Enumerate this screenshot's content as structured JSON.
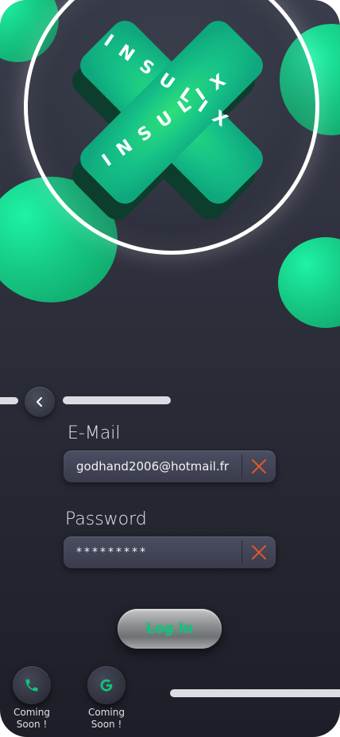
{
  "brand": {
    "logo_text_top": "INSULIX",
    "logo_text_bottom": "INSULIX",
    "logo_color": "#17c987",
    "ring_color": "#ffffff"
  },
  "colors": {
    "background": "#2b2d39",
    "accent": "#16c883",
    "clear_icon": "#e0572a",
    "login_text": "#0ec47c"
  },
  "nav": {
    "back_icon": "chevron-left-icon"
  },
  "form": {
    "email_label": "E-Mail",
    "email_value": "godhand2006@hotmail.fr",
    "password_label": "Password",
    "password_value": "*********",
    "clear_icon": "close-icon"
  },
  "actions": {
    "login_label": "Log In"
  },
  "social": [
    {
      "icon": "phone-icon",
      "label_line1": "Coming",
      "label_line2": "Soon !"
    },
    {
      "icon": "google-icon",
      "label_line1": "Coming",
      "label_line2": "Soon !"
    }
  ]
}
